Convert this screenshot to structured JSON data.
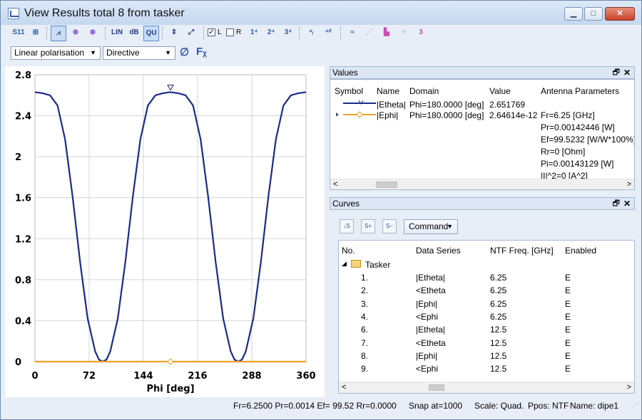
{
  "window": {
    "title": "View Results total 8 from tasker",
    "controls": [
      "minimize",
      "maximize",
      "close"
    ]
  },
  "toolbar": {
    "checkbox_l_label": "L",
    "checkbox_l_checked": true,
    "checkbox_r_label": "R",
    "checkbox_r_checked": false,
    "icons": [
      "s11-icon",
      "grid-icon",
      "polar-plot-icon",
      "smith-chart-icon",
      "multi-smith-icon",
      "lin-scale-icon",
      "db-scale-icon",
      "quad-scale-icon",
      "snap-marker-icon",
      "zoom-fit-icon",
      "legend-icon",
      "phi1-icon",
      "phi2-icon",
      "phi3-icon",
      "theta-icon",
      "phi-def-icon",
      "wave-icon",
      "dotted-wave-icon",
      "bar-icon",
      "dots-icon",
      "three-d-icon"
    ]
  },
  "selectors": {
    "polarisation": "Linear polarisation",
    "mode": "Directive"
  },
  "chart_data": {
    "type": "line",
    "title": "",
    "xlabel": "Phi [deg]",
    "ylabel": "",
    "xlim": [
      0,
      360
    ],
    "ylim": [
      0,
      2.8
    ],
    "x_ticks": [
      "0",
      "72",
      "144",
      "216",
      "288",
      "360"
    ],
    "y_ticks": [
      "0",
      "0.4",
      "0.8",
      "1.2",
      "1.6",
      "2",
      "2.4",
      "2.8"
    ],
    "grid": true,
    "x": [
      0,
      10,
      20,
      30,
      40,
      50,
      60,
      70,
      80,
      85,
      90,
      95,
      100,
      110,
      120,
      130,
      140,
      150,
      160,
      170,
      180,
      190,
      200,
      210,
      220,
      230,
      240,
      250,
      260,
      265,
      270,
      275,
      280,
      290,
      300,
      310,
      320,
      330,
      340,
      350,
      360
    ],
    "series": [
      {
        "color": "#1b2a8a",
        "values": [
          2.63,
          2.62,
          2.6,
          2.5,
          2.17,
          1.61,
          0.97,
          0.42,
          0.1,
          0.02,
          0.0,
          0.02,
          0.1,
          0.42,
          0.97,
          1.61,
          2.17,
          2.5,
          2.6,
          2.62,
          2.63,
          2.62,
          2.6,
          2.5,
          2.17,
          1.61,
          0.97,
          0.42,
          0.1,
          0.02,
          0.0,
          0.02,
          0.1,
          0.42,
          0.97,
          1.61,
          2.17,
          2.5,
          2.6,
          2.62,
          2.63
        ]
      },
      {
        "color": "#f0a020",
        "values": [
          0.0,
          0.0,
          0.0,
          0.0,
          0.0,
          0.0,
          0.0,
          0.0,
          0.0,
          0.0,
          0.0,
          0.0,
          0.0,
          0.0,
          0.0,
          0.0,
          0.0,
          0.0,
          0.0,
          0.0,
          0.0,
          0.0,
          0.0,
          0.0,
          0.0,
          0.0,
          0.0,
          0.0,
          0.0,
          0.0,
          0.0,
          0.0,
          0.0,
          0.0,
          0.0,
          0.0,
          0.0,
          0.0,
          0.0,
          0.0,
          0.0
        ]
      }
    ]
  },
  "values_panel": {
    "title": "Values",
    "columns": [
      "Symbol",
      "Name",
      "Domain",
      "Value",
      "Antenna Parameters"
    ],
    "rows": [
      {
        "name": "|Etheta|",
        "domain": "Phi=180.0000 [deg]",
        "value": "2.651769",
        "params": []
      },
      {
        "name": "|Ephi|",
        "domain": "Phi=180.0000 [deg]",
        "value": "2.64614e-12",
        "params": [
          "Fr=6.25 [GHz]",
          "Pr=0.00142446 [W]",
          "Ef=99.5232 [W/W*100%]",
          "Rr=0 [Ohm]",
          "Pi=0.00143129 [W]",
          "|I|^2=0 [A^2]"
        ]
      }
    ]
  },
  "curves_panel": {
    "title": "Curves",
    "command_label": "Command",
    "columns": [
      "No.",
      "Data Series",
      "NTF Freq. [GHz]",
      "Enabled"
    ],
    "group": "Tasker",
    "rows": [
      {
        "no": "1.",
        "series": "|Etheta|",
        "freq": "6.25",
        "enabled": "E"
      },
      {
        "no": "2.",
        "series": "<Etheta",
        "freq": "6.25",
        "enabled": "E"
      },
      {
        "no": "3.",
        "series": "|Ephi|",
        "freq": "6.25",
        "enabled": "E"
      },
      {
        "no": "4.",
        "series": "<Ephi",
        "freq": "6.25",
        "enabled": "E"
      },
      {
        "no": "6.",
        "series": "|Etheta|",
        "freq": "12.5",
        "enabled": "E"
      },
      {
        "no": "7.",
        "series": "<Etheta",
        "freq": "12.5",
        "enabled": "E"
      },
      {
        "no": "8.",
        "series": "|Ephi|",
        "freq": "12.5",
        "enabled": "E"
      },
      {
        "no": "9.",
        "series": "<Ephi",
        "freq": "12.5",
        "enabled": "E"
      }
    ]
  },
  "statusbar": {
    "params": "Fr=6.2500 Pr=0.0014 Ef= 99.52 Rr=0.0000",
    "snap": "Snap at=1000",
    "scale": "Scale: Quad.",
    "ppos": "Ppos: NTF",
    "name": "Name: dipe1"
  }
}
